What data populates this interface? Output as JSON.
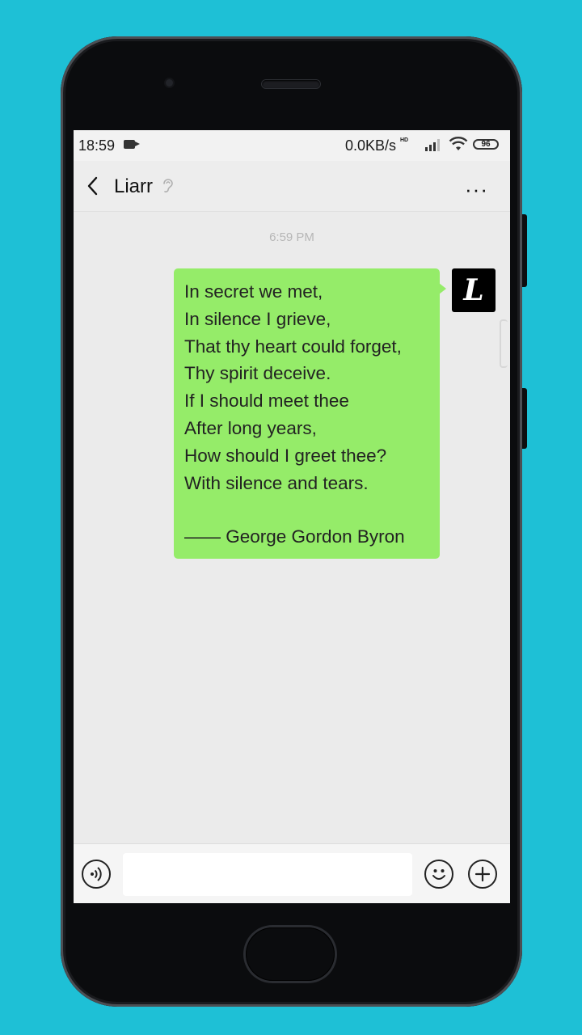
{
  "status_bar": {
    "time": "18:59",
    "network_speed": "0.0KB/s",
    "signal_label": "HD",
    "battery_level": "96"
  },
  "chat": {
    "title": "Liarr",
    "timestamp": "6:59 PM",
    "avatar_letter": "L",
    "message_lines": [
      "In secret we met,",
      "In silence I grieve,",
      "That thy heart could forget,",
      "Thy spirit deceive.",
      "If I should meet thee",
      "After long years,",
      "How should I greet thee?",
      "With silence and tears."
    ],
    "signature": "—— George Gordon Byron"
  },
  "input_bar": {
    "placeholder": ""
  },
  "colors": {
    "background": "#1ec0d6",
    "bubble": "#95ec69",
    "chat_bg": "#ebebeb"
  }
}
